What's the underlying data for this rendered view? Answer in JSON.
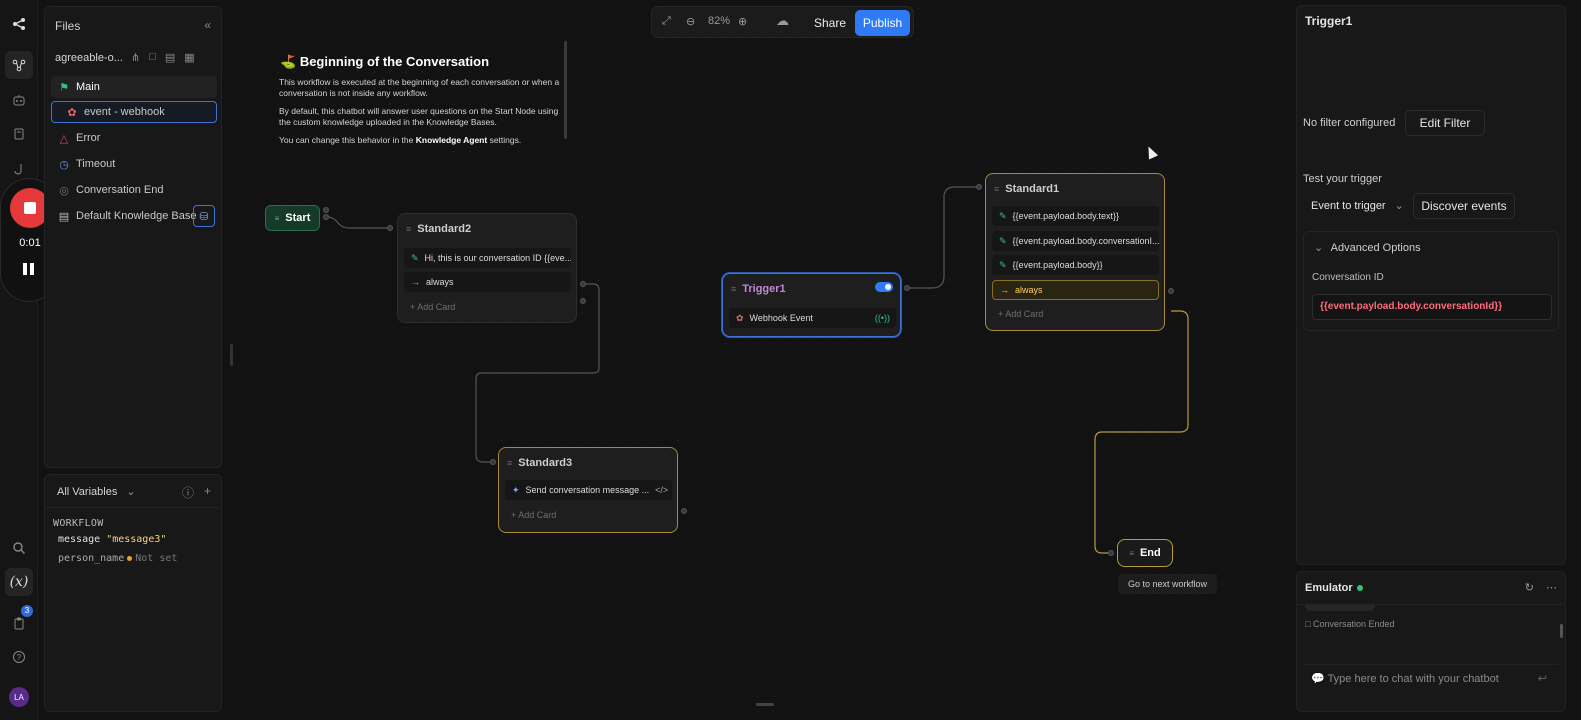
{
  "files": {
    "title": "Files",
    "project": "agreeable-o...",
    "items": [
      {
        "label": "Main",
        "icon": "flag-icon"
      },
      {
        "label": "event - webhook",
        "icon": "webhook-icon"
      },
      {
        "label": "Error",
        "icon": "warning-icon"
      },
      {
        "label": "Timeout",
        "icon": "clock-icon"
      },
      {
        "label": "Conversation End",
        "icon": "circle-icon"
      },
      {
        "label": "Default Knowledge Base",
        "icon": "book-icon"
      }
    ]
  },
  "recorder": {
    "time": "0:01"
  },
  "rail": {
    "badge": "3",
    "avatar": "LA"
  },
  "variables": {
    "dropdown": "All Variables",
    "section": "WORKFLOW",
    "rows": [
      {
        "name": "message",
        "value": "\"message3\""
      },
      {
        "name": "person_name",
        "value": "Not set"
      }
    ]
  },
  "toolbar": {
    "zoom": "82%",
    "share": "Share",
    "publish": "Publish"
  },
  "note": {
    "title": "Beginning of the Conversation",
    "p1": "This workflow is executed at the beginning of each conversation or when a conversation is not inside any workflow.",
    "p2": "By default, this chatbot will answer user questions on the Start Node using the custom knowledge uploaded in the Knowledge Bases.",
    "p3_a": "You can change this behavior in the ",
    "p3_b": "Knowledge Agent",
    "p3_c": " settings."
  },
  "nodes": {
    "start": "Start",
    "end": "End",
    "end_tooltip": "Go to next workflow",
    "standard2": {
      "title": "Standard2",
      "cards": [
        "Hi, this is our conversation ID {{eve...",
        "always"
      ],
      "add": "Add Card"
    },
    "standard3": {
      "title": "Standard3",
      "cards": [
        "Send conversation message ..."
      ],
      "add": "Add Card"
    },
    "trigger1": {
      "title": "Trigger1",
      "cards": [
        "Webhook Event"
      ]
    },
    "standard1": {
      "title": "Standard1",
      "cards": [
        "{{event.payload.body.text}}",
        "{{event.payload.body.conversationI...",
        "{{event.payload.body}}",
        "always"
      ],
      "add": "Add Card"
    }
  },
  "inspector": {
    "title": "Trigger1",
    "no_filter": "No filter configured",
    "edit_filter": "Edit Filter",
    "test_label": "Test your trigger",
    "event_select": "Event to trigger",
    "discover": "Discover events",
    "advanced": "Advanced Options",
    "conv_label": "Conversation ID",
    "conv_value": "{{event.payload.body.conversationId}}"
  },
  "emulator": {
    "title": "Emulator",
    "conversation_ended": "Conversation Ended",
    "chat_placeholder": "Type here to chat with your chatbot"
  },
  "colors": {
    "accent": "#2f7bf5",
    "record": "#e5383b",
    "gold": "#a8893a",
    "status_green": "#35c27a"
  }
}
